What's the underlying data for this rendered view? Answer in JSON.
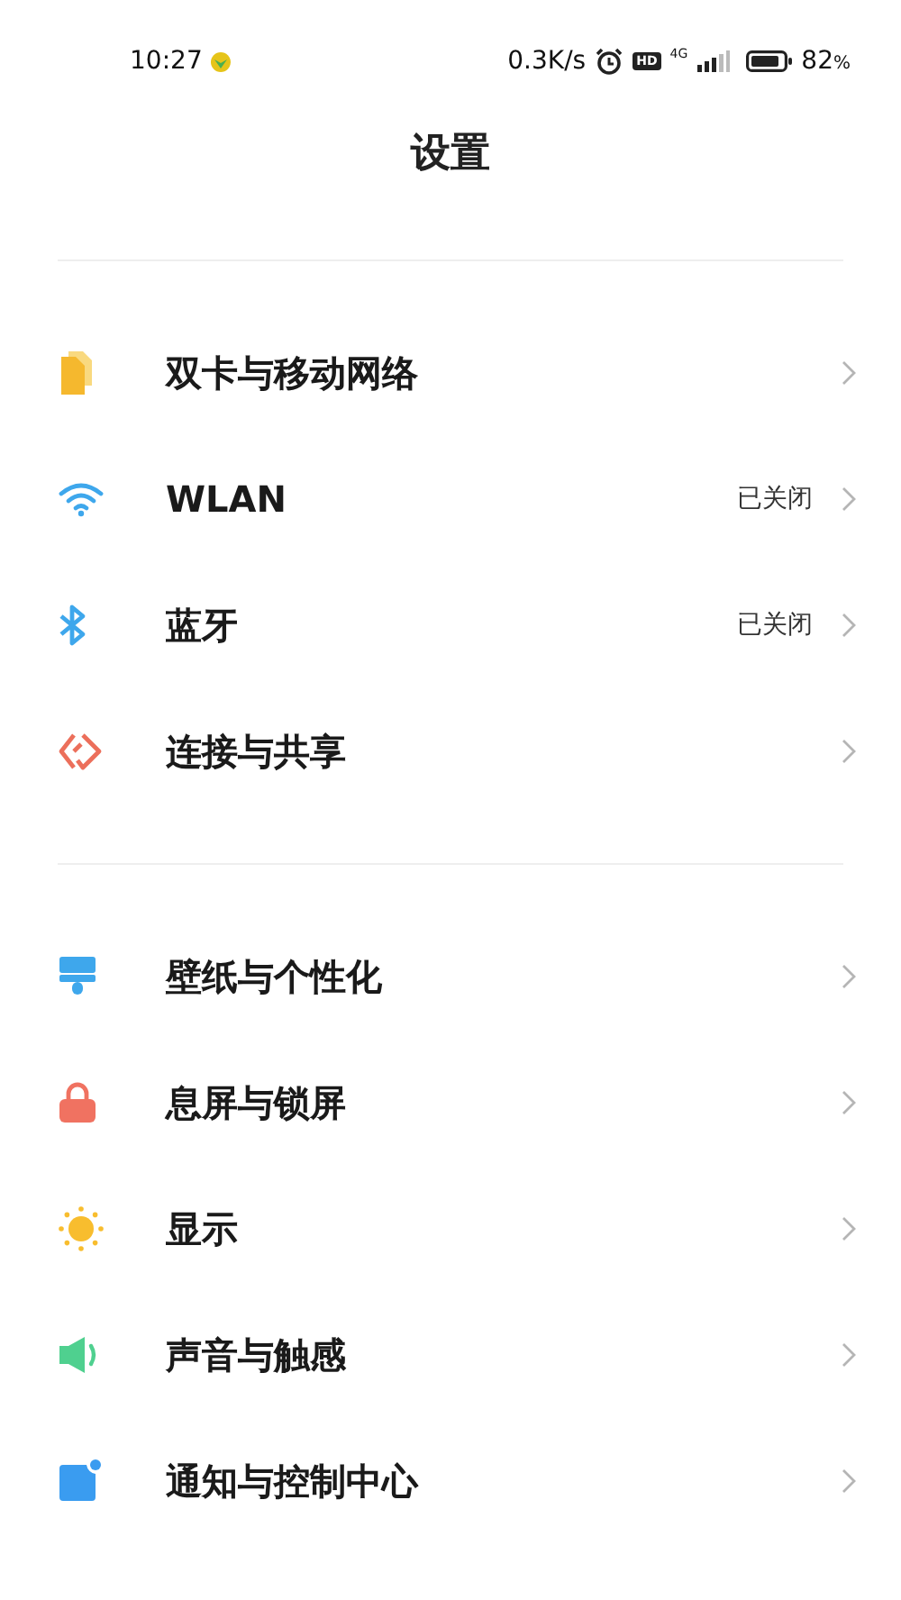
{
  "status_bar": {
    "time": "10:27",
    "net_speed": "0.3K/s",
    "hd": "HD",
    "network": "4G",
    "battery": {
      "percent": "82",
      "percent_sign": "%"
    }
  },
  "title": "设置",
  "sections": [
    {
      "items": [
        {
          "label": "双卡与移动网络"
        },
        {
          "label": "WLAN",
          "value": "已关闭"
        },
        {
          "label": "蓝牙",
          "value": "已关闭"
        },
        {
          "label": "连接与共享"
        }
      ]
    },
    {
      "items": [
        {
          "label": "壁纸与个性化"
        },
        {
          "label": "息屏与锁屏"
        },
        {
          "label": "显示"
        },
        {
          "label": "声音与触感"
        },
        {
          "label": "通知与控制中心"
        }
      ]
    }
  ]
}
